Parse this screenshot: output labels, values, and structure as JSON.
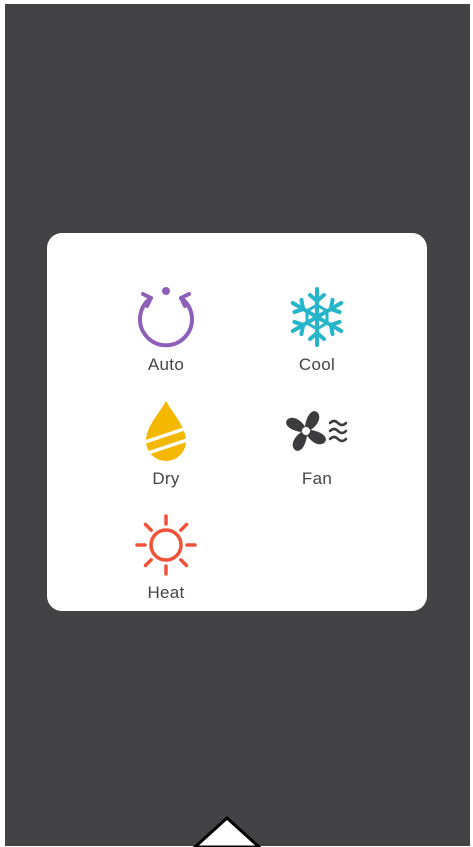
{
  "modes": [
    {
      "label": "Auto",
      "icon": "auto-cycle-icon",
      "color": "#8e5fb8"
    },
    {
      "label": "Cool",
      "icon": "snowflake-icon",
      "color": "#27b6c9"
    },
    {
      "label": "Dry",
      "icon": "water-drop-icon",
      "color": "#f5b800"
    },
    {
      "label": "Fan",
      "icon": "fan-icon",
      "color": "#3c3c3e"
    },
    {
      "label": "Heat",
      "icon": "sun-icon",
      "color": "#f0533a"
    }
  ],
  "colors": {
    "background": "#434345",
    "popup": "#ffffff",
    "label": "#444444"
  }
}
